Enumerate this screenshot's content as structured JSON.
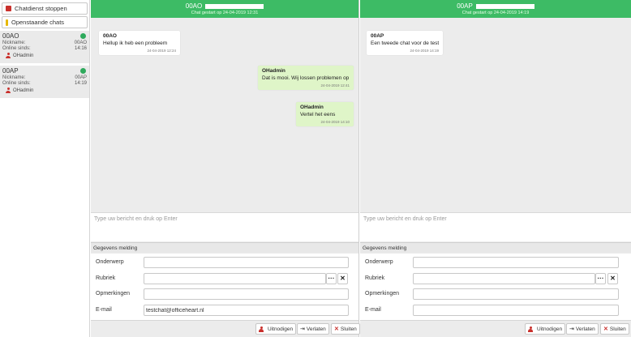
{
  "sidebar": {
    "stop_button": "Chatdienst stoppen",
    "open_button": "Openstaande chats",
    "chats": [
      {
        "title": "00AO",
        "nickname_label": "Nickname:",
        "nickname": "00AO",
        "online_label": "Online sinds:",
        "online": "14:16",
        "user": "OHadmin",
        "status_color": "#2eaa5c"
      },
      {
        "title": "00AP",
        "nickname_label": "Nickname:",
        "nickname": "00AP",
        "online_label": "Online sinds:",
        "online": "14:19",
        "user": "OHadmin",
        "status_color": "#2eaa5c"
      }
    ]
  },
  "panes": [
    {
      "title": "00AO",
      "subtitle": "Chat gestart op 24-04-2019 12:31",
      "messages": [
        {
          "who": "00AO",
          "text": "Hellup ik heb een probleem",
          "ts": "24-04-2019 12:24"
        },
        {
          "who": "OHadmin",
          "text": "Dat is mooi. Wij lossen problemen op",
          "ts": "24-04-2019 12:41"
        },
        {
          "who": "OHadmin",
          "text": "Vertel het eens",
          "ts": "24-04-2019 14:10"
        }
      ],
      "input_placeholder": "Type uw bericht en druk op Enter",
      "section_title": "Gegevens melding",
      "fields": {
        "onderwerp": "Onderwerp",
        "rubriek": "Rubriek",
        "opmerkingen": "Opmerkingen",
        "email": "E-mail"
      },
      "email_value": "testchat@officeheart.nl",
      "buttons": {
        "invite": "Uitnodigen",
        "leave": "Verlaten",
        "close": "Sluiten"
      }
    },
    {
      "title": "00AP",
      "subtitle": "Chat gestart op 24-04-2019 14:19",
      "messages": [
        {
          "who": "00AP",
          "text": "Een tweede chat voor de test",
          "ts": "24-04-2019 14:19"
        }
      ],
      "input_placeholder": "Type uw bericht en druk op Enter",
      "section_title": "Gegevens melding",
      "fields": {
        "onderwerp": "Onderwerp",
        "rubriek": "Rubriek",
        "opmerkingen": "Opmerkingen",
        "email": "E-mail"
      },
      "email_value": "",
      "buttons": {
        "invite": "Uitnodigen",
        "leave": "Verlaten",
        "close": "Sluiten"
      }
    }
  ],
  "colors": {
    "header_green": "#3dbb65",
    "status_green": "#2eaa5c",
    "danger_red": "#c9302c",
    "outgoing_bubble": "#dff5c8"
  },
  "icons": {
    "stop": "stop-square-icon",
    "open": "exclamation-icon",
    "user": "user-icon",
    "more": "ellipsis-icon",
    "clear": "close-icon",
    "leave": "exit-arrow-icon"
  }
}
